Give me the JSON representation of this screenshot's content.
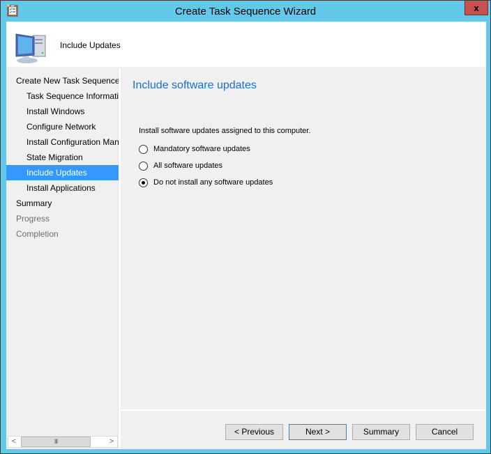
{
  "window": {
    "title": "Create Task Sequence Wizard",
    "close_label": "x"
  },
  "header": {
    "title": "Include Updates",
    "icon": "computer-icon"
  },
  "sidebar": {
    "items": [
      {
        "label": "Create New Task Sequence",
        "level": 0,
        "state": "normal"
      },
      {
        "label": "Task Sequence Information",
        "level": 1,
        "state": "normal"
      },
      {
        "label": "Install Windows",
        "level": 1,
        "state": "normal"
      },
      {
        "label": "Configure Network",
        "level": 1,
        "state": "normal"
      },
      {
        "label": "Install Configuration Manager",
        "level": 1,
        "state": "normal"
      },
      {
        "label": "State Migration",
        "level": 1,
        "state": "normal"
      },
      {
        "label": "Include Updates",
        "level": 1,
        "state": "selected"
      },
      {
        "label": "Install Applications",
        "level": 1,
        "state": "normal"
      },
      {
        "label": "Summary",
        "level": 0,
        "state": "normal"
      },
      {
        "label": "Progress",
        "level": 0,
        "state": "disabled"
      },
      {
        "label": "Completion",
        "level": 0,
        "state": "disabled"
      }
    ],
    "scrollbar": {
      "left_arrow": "<",
      "right_arrow": ">",
      "thumb_grip": "III"
    }
  },
  "content": {
    "title": "Include software updates",
    "instruction": "Install software updates assigned to this computer.",
    "options": [
      {
        "label": "Mandatory software updates",
        "checked": false
      },
      {
        "label": "All software updates",
        "checked": false
      },
      {
        "label": "Do not install any software updates",
        "checked": true
      }
    ]
  },
  "buttons": {
    "previous": "< Previous",
    "next": "Next >",
    "summary": "Summary",
    "cancel": "Cancel"
  },
  "colors": {
    "titlebar": "#63c9eb",
    "close": "#c75050",
    "selection": "#3399ff",
    "heading": "#1a6fcf"
  }
}
